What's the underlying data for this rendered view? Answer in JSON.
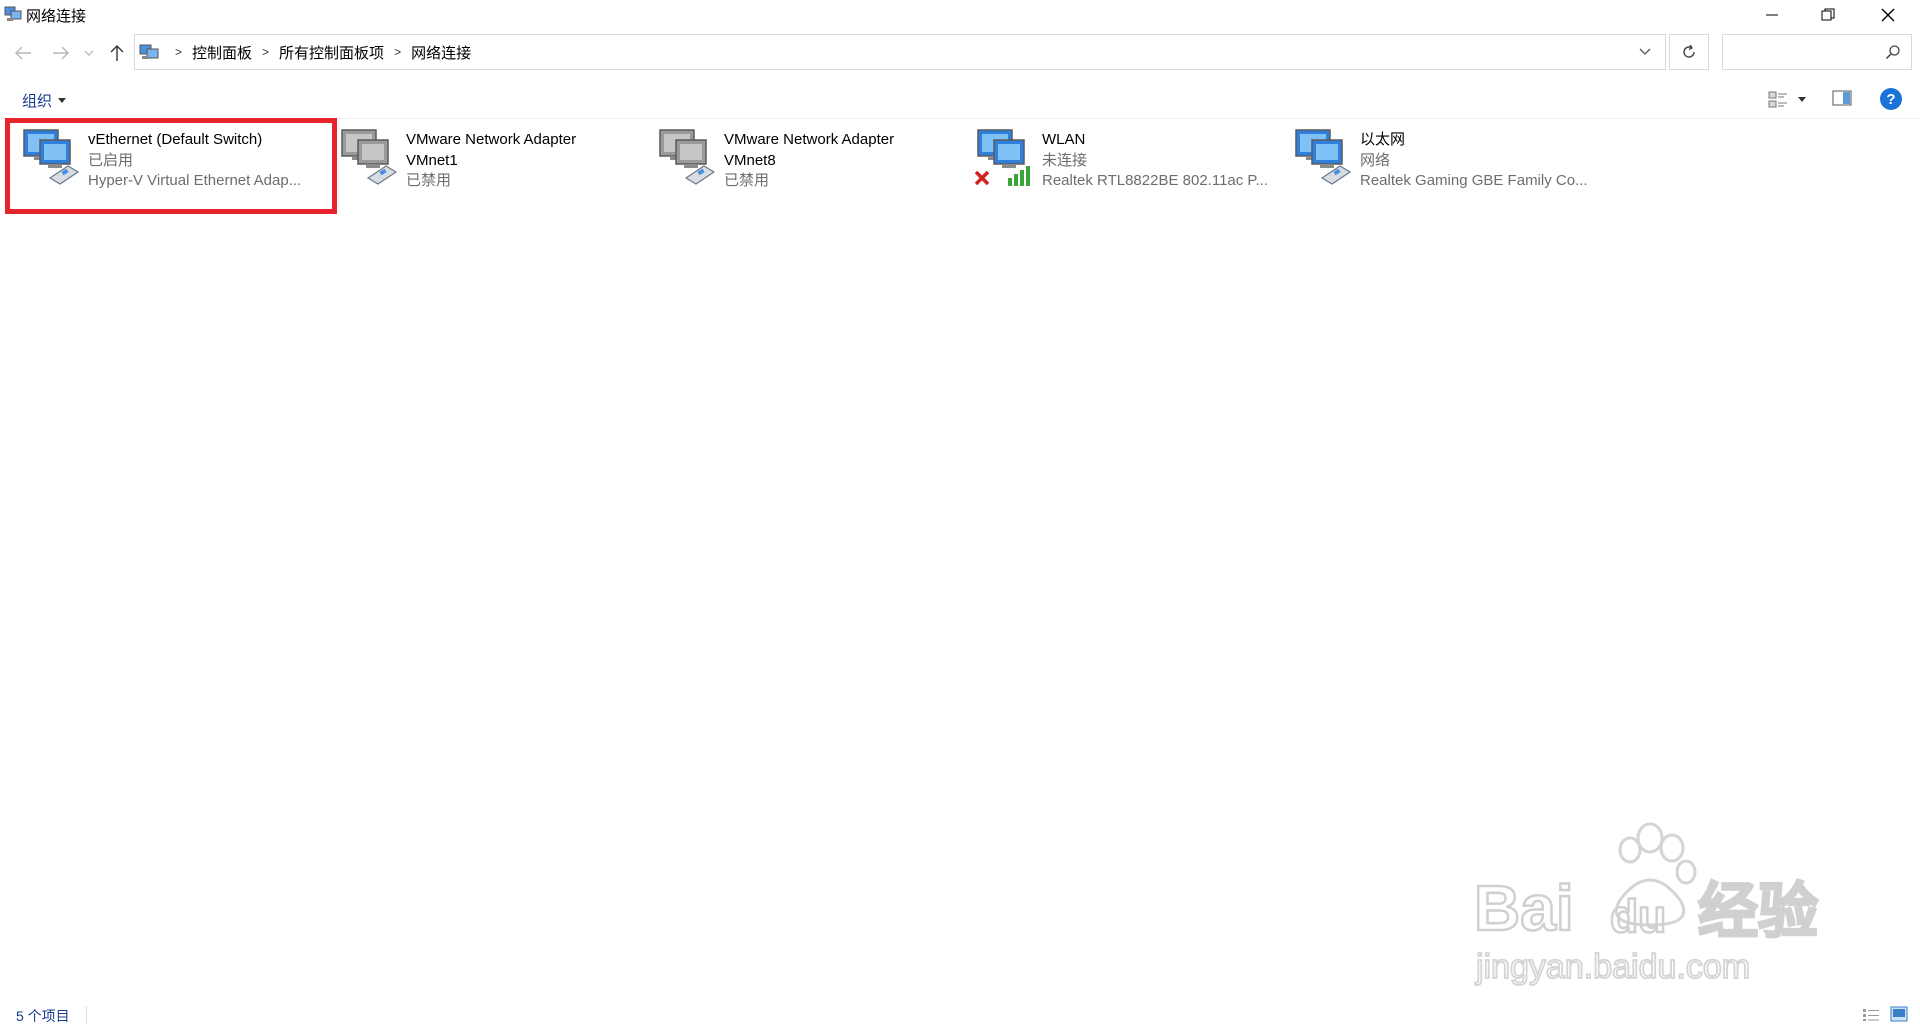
{
  "window": {
    "title": "网络连接",
    "controls": [
      "minimize",
      "restore",
      "close"
    ]
  },
  "navigation": {
    "back_icon": "back-arrow-icon",
    "forward_icon": "forward-arrow-icon",
    "recent_icon": "chevron-down-icon",
    "up_icon": "up-arrow-icon",
    "breadcrumbs": [
      "控制面板",
      "所有控制面板项",
      "网络连接"
    ],
    "search_placeholder": ""
  },
  "toolbar": {
    "organize_label": "组织"
  },
  "connections": [
    {
      "name": "vEthernet (Default Switch)",
      "name2": "",
      "status": "已启用",
      "device": "Hyper-V Virtual Ethernet Adap...",
      "icon": "network-adapter-icon",
      "state": "enabled",
      "highlighted": true
    },
    {
      "name": "VMware Network Adapter",
      "name2": "VMnet1",
      "status": "已禁用",
      "device": "",
      "icon": "network-adapter-icon",
      "state": "disabled",
      "highlighted": false
    },
    {
      "name": "VMware Network Adapter",
      "name2": "VMnet8",
      "status": "已禁用",
      "device": "",
      "icon": "network-adapter-icon",
      "state": "disabled",
      "highlighted": false
    },
    {
      "name": "WLAN",
      "name2": "",
      "status": "未连接",
      "device": "Realtek RTL8822BE 802.11ac P...",
      "icon": "wifi-adapter-icon",
      "state": "disconnected",
      "highlighted": false
    },
    {
      "name": "以太网",
      "name2": "",
      "status": "网络",
      "device": "Realtek Gaming GBE Family Co...",
      "icon": "network-adapter-icon",
      "state": "connected",
      "highlighted": false
    }
  ],
  "status_bar": {
    "item_count": "5 个项目"
  },
  "watermark": {
    "text1": "Bai",
    "text2": "du",
    "text3": "经验",
    "url": "jingyan.baidu.com"
  },
  "colors": {
    "highlight_border": "#e8232b",
    "link_blue": "#1a3c8f",
    "help_blue": "#1a73d9"
  }
}
